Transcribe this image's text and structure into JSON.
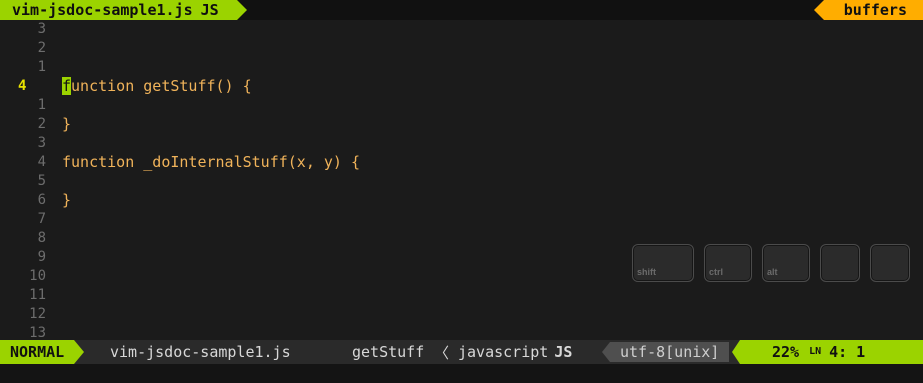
{
  "tabline": {
    "active_tab": "vim-jsdoc-sample1.js",
    "active_tab_ft_icon": "JS",
    "buffers_label": "buffers"
  },
  "editor": {
    "lines": [
      {
        "ln": "3",
        "text": ""
      },
      {
        "ln": "2",
        "text": ""
      },
      {
        "ln": "1",
        "text": ""
      },
      {
        "ln": "4",
        "current": true,
        "text": "function getStuff() {"
      },
      {
        "ln": "1",
        "text": ""
      },
      {
        "ln": "2",
        "text": "}"
      },
      {
        "ln": "3",
        "text": ""
      },
      {
        "ln": "4",
        "text": "function _doInternalStuff(x, y) {"
      },
      {
        "ln": "5",
        "text": ""
      },
      {
        "ln": "6",
        "text": "}"
      },
      {
        "ln": "7",
        "text": ""
      },
      {
        "ln": "8",
        "text": ""
      },
      {
        "ln": "9",
        "text": ""
      },
      {
        "ln": "10",
        "text": ""
      },
      {
        "ln": "11",
        "text": ""
      },
      {
        "ln": "12",
        "text": ""
      },
      {
        "ln": "13",
        "text": ""
      }
    ],
    "cursor_char": "f",
    "cursor_rest": "unction getStuff() {"
  },
  "key_overlay": {
    "keys": [
      "shift",
      "ctrl",
      "alt",
      "",
      ""
    ]
  },
  "statusline": {
    "mode": "NORMAL",
    "filename": "vim-jsdoc-sample1.js",
    "function": "getStuff",
    "separator": "〈",
    "filetype": "javascript",
    "filetype_icon": "JS",
    "encoding": "utf-8[unix]",
    "percent": "22%",
    "line_icon": "LN",
    "position": "4:  1"
  },
  "colors": {
    "accent_green": "#9bd300",
    "accent_orange": "#ffad00",
    "cursor_line_number": "#e8e200"
  }
}
